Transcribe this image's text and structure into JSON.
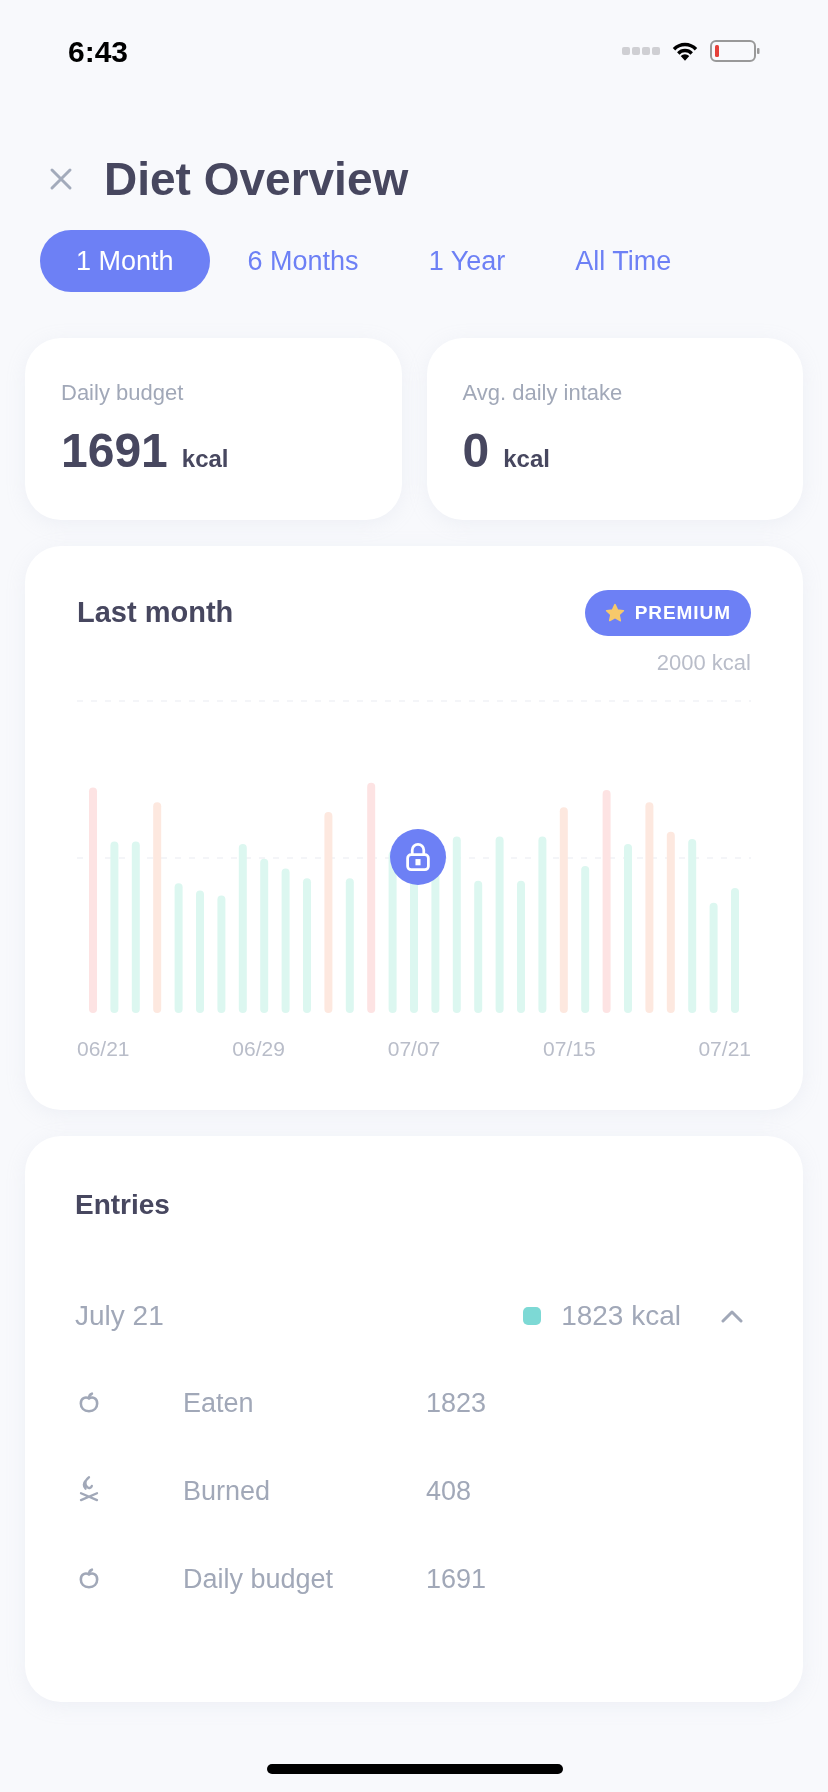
{
  "status_bar": {
    "time": "6:43"
  },
  "header": {
    "title": "Diet Overview"
  },
  "tabs": [
    {
      "label": "1 Month",
      "selected": true
    },
    {
      "label": "6 Months",
      "selected": false
    },
    {
      "label": "1 Year",
      "selected": false
    },
    {
      "label": "All Time",
      "selected": false
    }
  ],
  "stats": [
    {
      "label": "Daily budget",
      "value": "1691",
      "unit": "kcal"
    },
    {
      "label": "Avg. daily intake",
      "value": "0",
      "unit": "kcal"
    }
  ],
  "chart_card": {
    "title": "Last month",
    "badge": "PREMIUM",
    "y_label": "2000 kcal",
    "x_labels": [
      "06/21",
      "06/29",
      "07/07",
      "07/15",
      "07/21"
    ],
    "locked": true
  },
  "entries": {
    "title": "Entries",
    "days": [
      {
        "date": "July 21",
        "total": "1823 kcal",
        "color": "#7dd9d5",
        "expanded": true,
        "items": [
          {
            "kind": "apple",
            "label": "Eaten",
            "value": "1823"
          },
          {
            "kind": "flame",
            "label": "Burned",
            "value": "408"
          },
          {
            "kind": "apple",
            "label": "Daily budget",
            "value": "1691"
          }
        ]
      }
    ]
  }
}
